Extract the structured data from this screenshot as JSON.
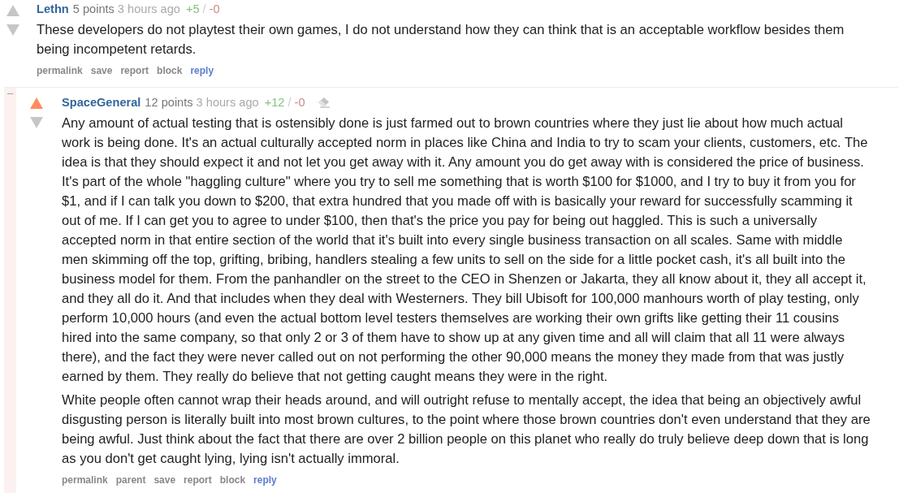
{
  "comments": [
    {
      "author": "Lethn",
      "score": "5 points",
      "time": "3 hours ago",
      "ups": "+5",
      "separator": "/",
      "downs": "-0",
      "upvoted": false,
      "eraser_mark": false,
      "paragraphs": [
        "These developers do not playtest their own games, I do not understand how they can think that is an acceptable workflow besides them being incompetent retards."
      ],
      "actions": [
        {
          "label": "permalink",
          "kind": "plain"
        },
        {
          "label": "save",
          "kind": "plain"
        },
        {
          "label": "report",
          "kind": "plain"
        },
        {
          "label": "block",
          "kind": "plain"
        },
        {
          "label": "reply",
          "kind": "reply"
        }
      ]
    },
    {
      "collapse_toggle": "–",
      "author": "SpaceGeneral",
      "score": "12 points",
      "time": "3 hours ago",
      "ups": "+12",
      "separator": "/",
      "downs": "-0",
      "upvoted": true,
      "eraser_mark": true,
      "paragraphs": [
        "Any amount of actual testing that is ostensibly done is just farmed out to brown countries where they just lie about how much actual work is being done. It's an actual culturally accepted norm in places like China and India to try to scam your clients, customers, etc. The idea is that they should expect it and not let you get away with it. Any amount you do get away with is considered the price of business. It's part of the whole \"haggling culture\" where you try to sell me something that is worth $100 for $1000, and I try to buy it from you for $1, and if I can talk you down to $200, that extra hundred that you made off with is basically your reward for successfully scamming it out of me. If I can get you to agree to under $100, then that's the price you pay for being out haggled. This is such a universally accepted norm in that entire section of the world that it's built into every single business transaction on all scales. Same with middle men skimming off the top, grifting, bribing, handlers stealing a few units to sell on the side for a little pocket cash, it's all built into the business model for them. From the panhandler on the street to the CEO in Shenzen or Jakarta, they all know about it, they all accept it, and they all do it. And that includes when they deal with Westerners. They bill Ubisoft for 100,000 manhours worth of play testing, only perform 10,000 hours (and even the actual bottom level testers themselves are working their own grifts like getting their 11 cousins hired into the same company, so that only 2 or 3 of them have to show up at any given time and all will claim that all 11 were always there), and the fact they were never called out on not performing the other 90,000 means the money they made from that was justly earned by them. They really do believe that not getting caught means they were in the right.",
        "White people often cannot wrap their heads around, and will outright refuse to mentally accept, the idea that being an objectively awful disgusting person is literally built into most brown cultures, to the point where those brown countries don't even understand that they are being awful. Just think about the fact that there are over 2 billion people on this planet who really do truly believe deep down that is long as you don't get caught lying, lying isn't actually immoral."
      ],
      "actions": [
        {
          "label": "permalink",
          "kind": "plain"
        },
        {
          "label": "parent",
          "kind": "plain"
        },
        {
          "label": "save",
          "kind": "plain"
        },
        {
          "label": "report",
          "kind": "plain"
        },
        {
          "label": "block",
          "kind": "plain"
        },
        {
          "label": "reply",
          "kind": "reply"
        }
      ]
    }
  ]
}
